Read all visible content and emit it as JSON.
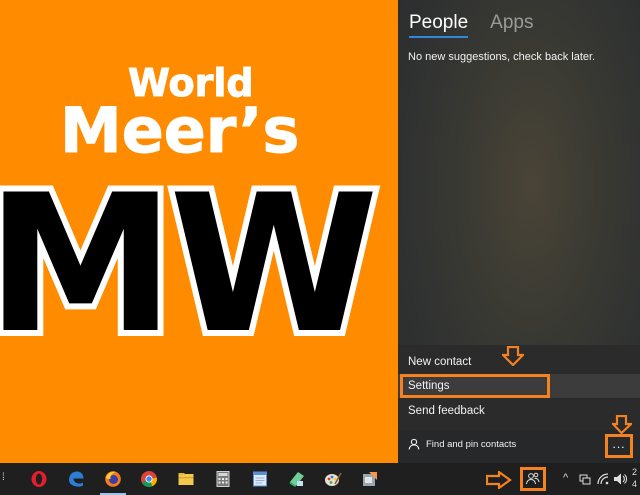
{
  "wallpaper": {
    "line1": "World",
    "line2": "Meer’s",
    "line3": "MW"
  },
  "people_panel": {
    "tabs": [
      {
        "label": "People",
        "active": true
      },
      {
        "label": "Apps",
        "active": false
      }
    ],
    "message": "No new suggestions, check back later.",
    "menu": [
      {
        "label": "New contact"
      },
      {
        "label": "Settings",
        "highlighted": true
      },
      {
        "label": "Send feedback"
      }
    ],
    "find_pin_label": "Find and pin contacts",
    "more_label": "..."
  },
  "taskbar": {
    "left_edge": "⁞",
    "apps": [
      "opera",
      "edge",
      "firefox",
      "chrome",
      "file-explorer",
      "calculator",
      "notepad",
      "paint-3d",
      "paint",
      "app"
    ],
    "clock_lines": [
      "2",
      "4"
    ]
  },
  "colors": {
    "wallpaper": "#FF8C00",
    "panel": "#2f3131",
    "highlight": "#f58220",
    "taskbar": "#1f1f1f"
  }
}
